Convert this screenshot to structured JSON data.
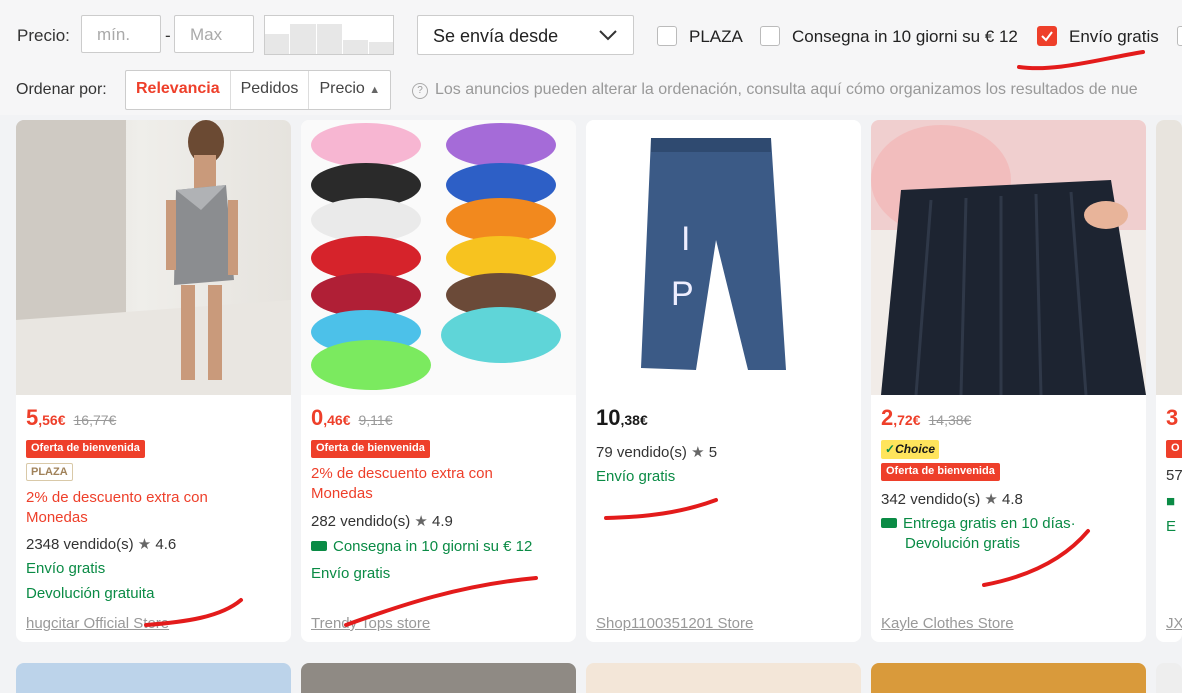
{
  "filters": {
    "price_label": "Precio:",
    "min_placeholder": "mín.",
    "max_placeholder": "Max",
    "dash": "-",
    "ship_from": "Se envía desde",
    "checkboxes": [
      {
        "label": "PLAZA",
        "checked": false
      },
      {
        "label": "Consegna in 10 giorni su € 12",
        "checked": false
      },
      {
        "label": "Envío gratis",
        "checked": true
      }
    ]
  },
  "sort": {
    "label": "Ordenar por:",
    "options": [
      "Relevancia",
      "Pedidos",
      "Precio"
    ],
    "active": "Relevancia",
    "note": "Los anuncios pueden alterar la ordenación, consulta aquí cómo organizamos los resultados de nue"
  },
  "colors": {
    "accent": "#ee3f2a",
    "green": "#0a8b45",
    "annotation": "#e31b1b"
  },
  "products": [
    {
      "image": "woman in silver one-shoulder mini dress",
      "price_int": "5",
      "price_dec": ",56€",
      "old_price": "16,77€",
      "badge": "Oferta de bienvenida",
      "plaza": "PLAZA",
      "promo": "2% de descuento extra con Monedas",
      "sold": "2348 vendido(s)",
      "rating": "4.6",
      "shipping": "Envío gratis",
      "returns": "Devolución gratuita",
      "store": "hugcitar Official Store"
    },
    {
      "image": "colorful tulle tutu skirts",
      "price_int": "0",
      "price_dec": ",46€",
      "old_price": "9,11€",
      "badge": "Oferta de bienvenida",
      "promo": "2% de descuento extra con Monedas",
      "sold": "282 vendido(s)",
      "rating": "4.9",
      "delivery": "Consegna in 10 giorni su € 12",
      "shipping": "Envío gratis",
      "store": "Trendy Tops store"
    },
    {
      "image": "blue jeans with white letters",
      "price_int": "10",
      "price_dec": ",38€",
      "sold": "79 vendido(s)",
      "rating": "5",
      "shipping": "Envío gratis",
      "store": "Shop1100351201 Store"
    },
    {
      "image": "woman in black pleated mini skirt",
      "price_int": "2",
      "price_dec": ",72€",
      "old_price": "14,38€",
      "choice": "Choice",
      "badge": "Oferta de bienvenida",
      "sold": "342 vendido(s)",
      "rating": "4.8",
      "delivery": "Entrega gratis en 10 días·",
      "returns": "Devolución gratis",
      "store": "Kayle Clothes Store"
    },
    {
      "price_int": "3",
      "badge": "O",
      "sold": "57",
      "delivery": "",
      "shipping": "E",
      "store": "JXN"
    }
  ]
}
